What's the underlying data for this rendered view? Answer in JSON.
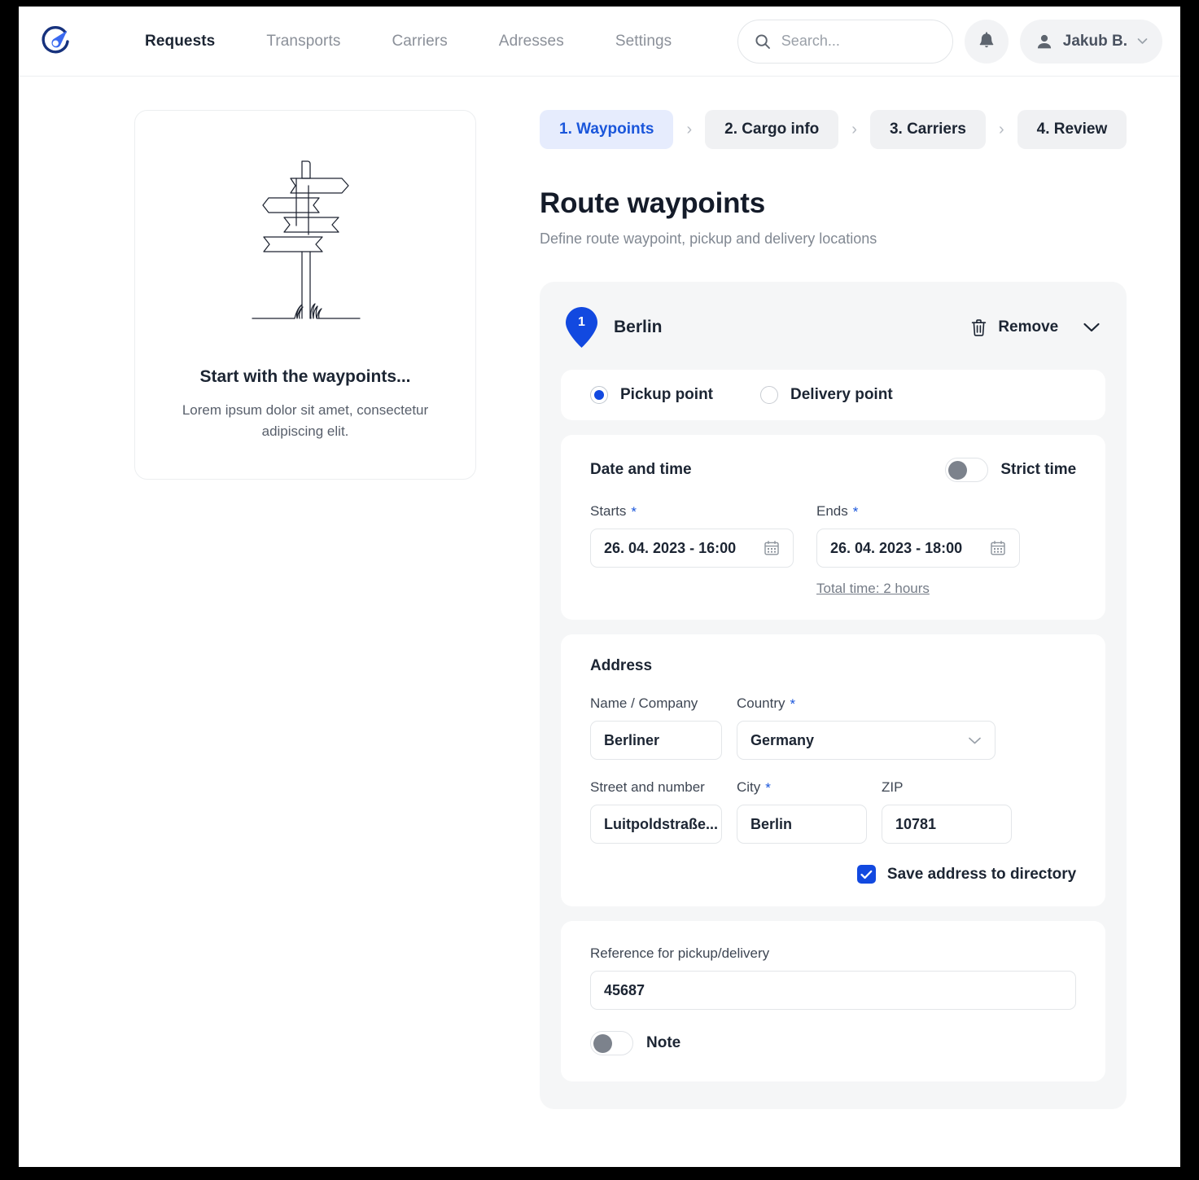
{
  "brand": {
    "logo_icon": "compass-logo-icon",
    "accent": "#1249e0",
    "accent_soft": "#e6ecfd"
  },
  "header": {
    "nav": [
      {
        "label": "Requests",
        "active": true
      },
      {
        "label": "Transports",
        "active": false
      },
      {
        "label": "Carriers",
        "active": false
      },
      {
        "label": "Adresses",
        "active": false
      },
      {
        "label": "Settings",
        "active": false
      }
    ],
    "search": {
      "placeholder": "Search...",
      "value": "",
      "icon": "search-icon"
    },
    "notifications_icon": "bell-icon",
    "user": {
      "name": "Jakub B.",
      "avatar_icon": "person-icon",
      "caret_icon": "chevron-down-icon"
    }
  },
  "promo": {
    "illustration": "signpost-illustration",
    "title": "Start with the waypoints...",
    "text": "Lorem ipsum dolor sit amet, consectetur adipiscing elit."
  },
  "steps": [
    {
      "label": "1. Waypoints",
      "active": true
    },
    {
      "label": "2. Cargo info",
      "active": false
    },
    {
      "label": "3. Carriers",
      "active": false
    },
    {
      "label": "4. Review",
      "active": false
    }
  ],
  "step_separator": "›",
  "page": {
    "title": "Route waypoints",
    "subtitle": "Define route waypoint, pickup and delivery locations"
  },
  "waypoint": {
    "index": "1",
    "city": "Berlin",
    "remove_label": "Remove",
    "remove_icon": "trash-icon",
    "collapse_icon": "chevron-down-icon",
    "point_type": {
      "options": [
        {
          "label": "Pickup point",
          "selected": true
        },
        {
          "label": "Delivery point",
          "selected": false
        }
      ]
    },
    "datetime": {
      "heading": "Date and time",
      "strict_time": {
        "label": "Strict time",
        "on": false
      },
      "starts": {
        "label": "Starts",
        "required": "*",
        "value": "26. 04. 2023 - 16:00",
        "icon": "calendar-icon"
      },
      "ends": {
        "label": "Ends",
        "required": "*",
        "value": "26. 04. 2023 - 18:00",
        "icon": "calendar-icon"
      },
      "total_time": "Total time: 2 hours"
    },
    "address": {
      "heading": "Address",
      "name": {
        "label": "Name / Company",
        "required": "",
        "value": "Berliner"
      },
      "country": {
        "label": "Country",
        "required": "*",
        "value": "Germany",
        "icon": "chevron-down-icon"
      },
      "street": {
        "label": "Street and number",
        "required": "",
        "value": "Luitpoldstraße..."
      },
      "city": {
        "label": "City",
        "required": "*",
        "value": "Berlin"
      },
      "zip": {
        "label": "ZIP",
        "required": "",
        "value": "10781"
      },
      "save_to_directory": {
        "label": "Save address to directory",
        "checked": true,
        "icon": "check-icon"
      }
    },
    "reference": {
      "label": "Reference for pickup/delivery",
      "value": "45687",
      "note": {
        "label": "Note",
        "on": false
      }
    }
  }
}
